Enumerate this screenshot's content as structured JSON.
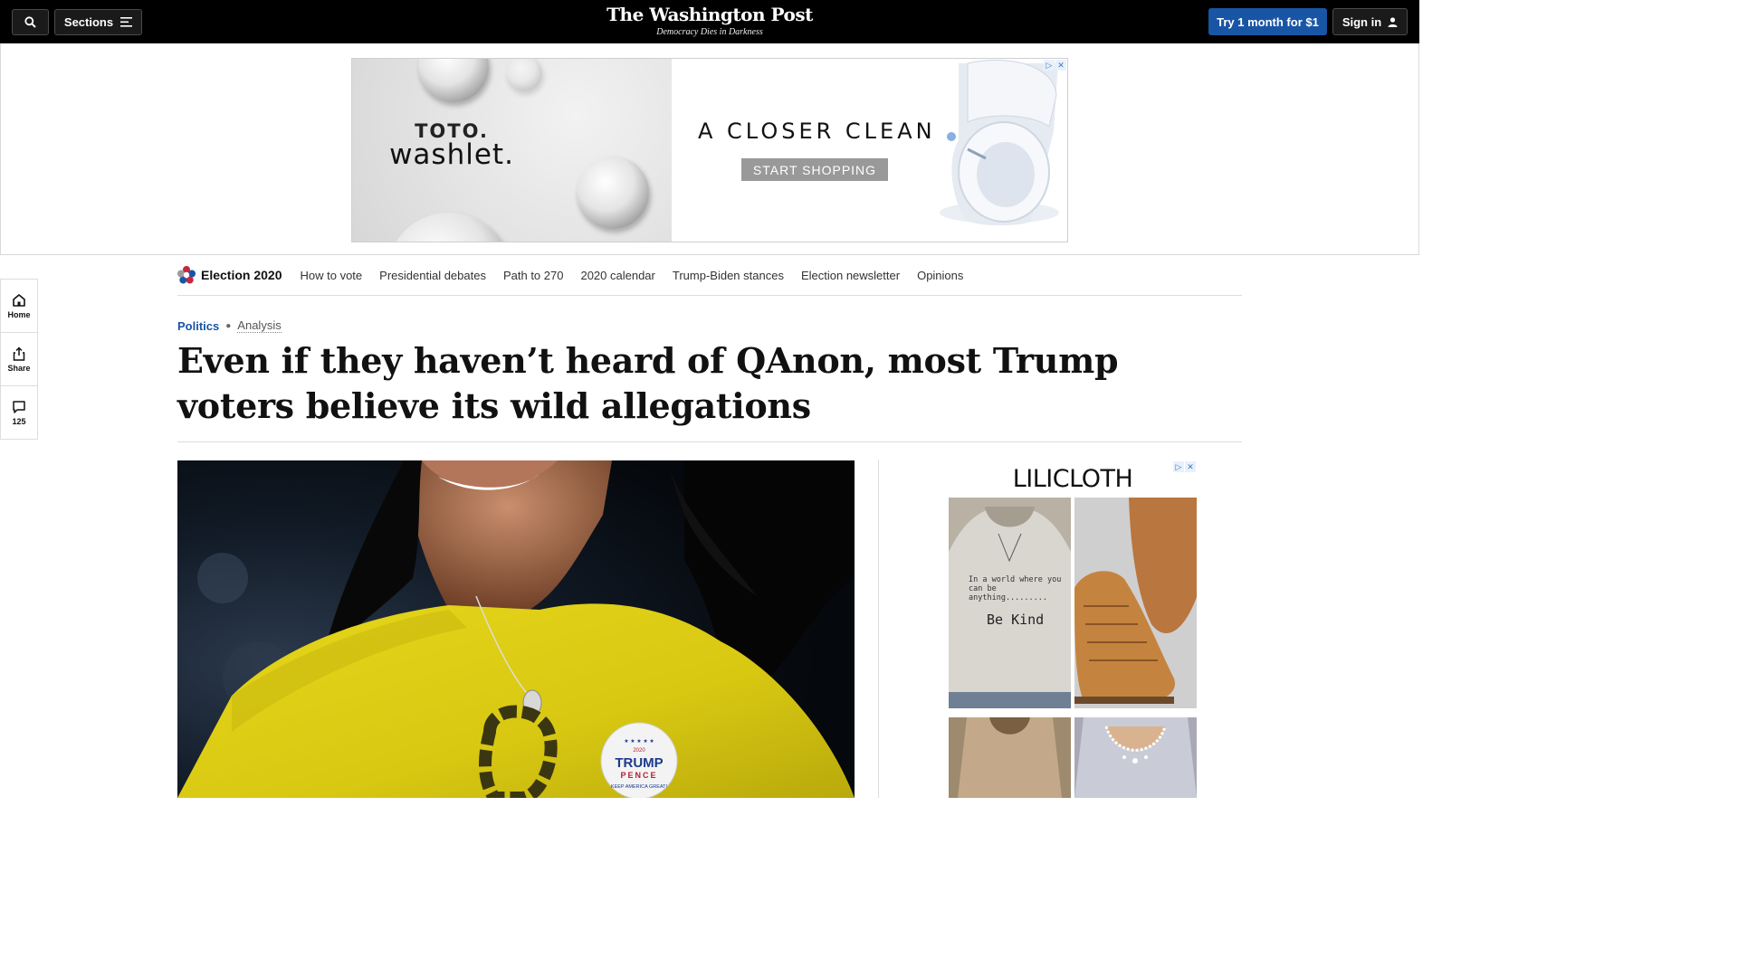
{
  "header": {
    "logo": "The Washington Post",
    "tagline": "Democracy Dies in Darkness",
    "sections_label": "Sections",
    "try_label": "Try 1 month for $1",
    "signin_label": "Sign in",
    "accent_color": "#1955a5"
  },
  "top_ad": {
    "brand_line1": "TOTO.",
    "brand_line2": "washlet.",
    "slogan": "A CLOSER CLEAN",
    "cta": "START SHOPPING"
  },
  "election_nav": {
    "title": "Election 2020",
    "items": [
      {
        "label": "How to vote"
      },
      {
        "label": "Presidential debates"
      },
      {
        "label": "Path to 270"
      },
      {
        "label": "2020 calendar"
      },
      {
        "label": "Trump-Biden stances"
      },
      {
        "label": "Election newsletter"
      },
      {
        "label": "Opinions"
      }
    ]
  },
  "rail": {
    "home": "Home",
    "share": "Share",
    "comments_count": "125"
  },
  "article": {
    "kicker_section": "Politics",
    "kicker_type": "Analysis",
    "headline": "Even if they haven’t heard of QAnon, most Trump voters believe its wild allegations"
  },
  "photo": {
    "button_line1": "TRUMP",
    "button_line2": "PENCE",
    "button_line3": "KEEP AMERICA GREAT!",
    "button_year": "2020"
  },
  "right_ad": {
    "brand": "LILICLOTH",
    "shirt_text": "In a world where you can be anything.........",
    "shirt_big": "Be Kind"
  }
}
